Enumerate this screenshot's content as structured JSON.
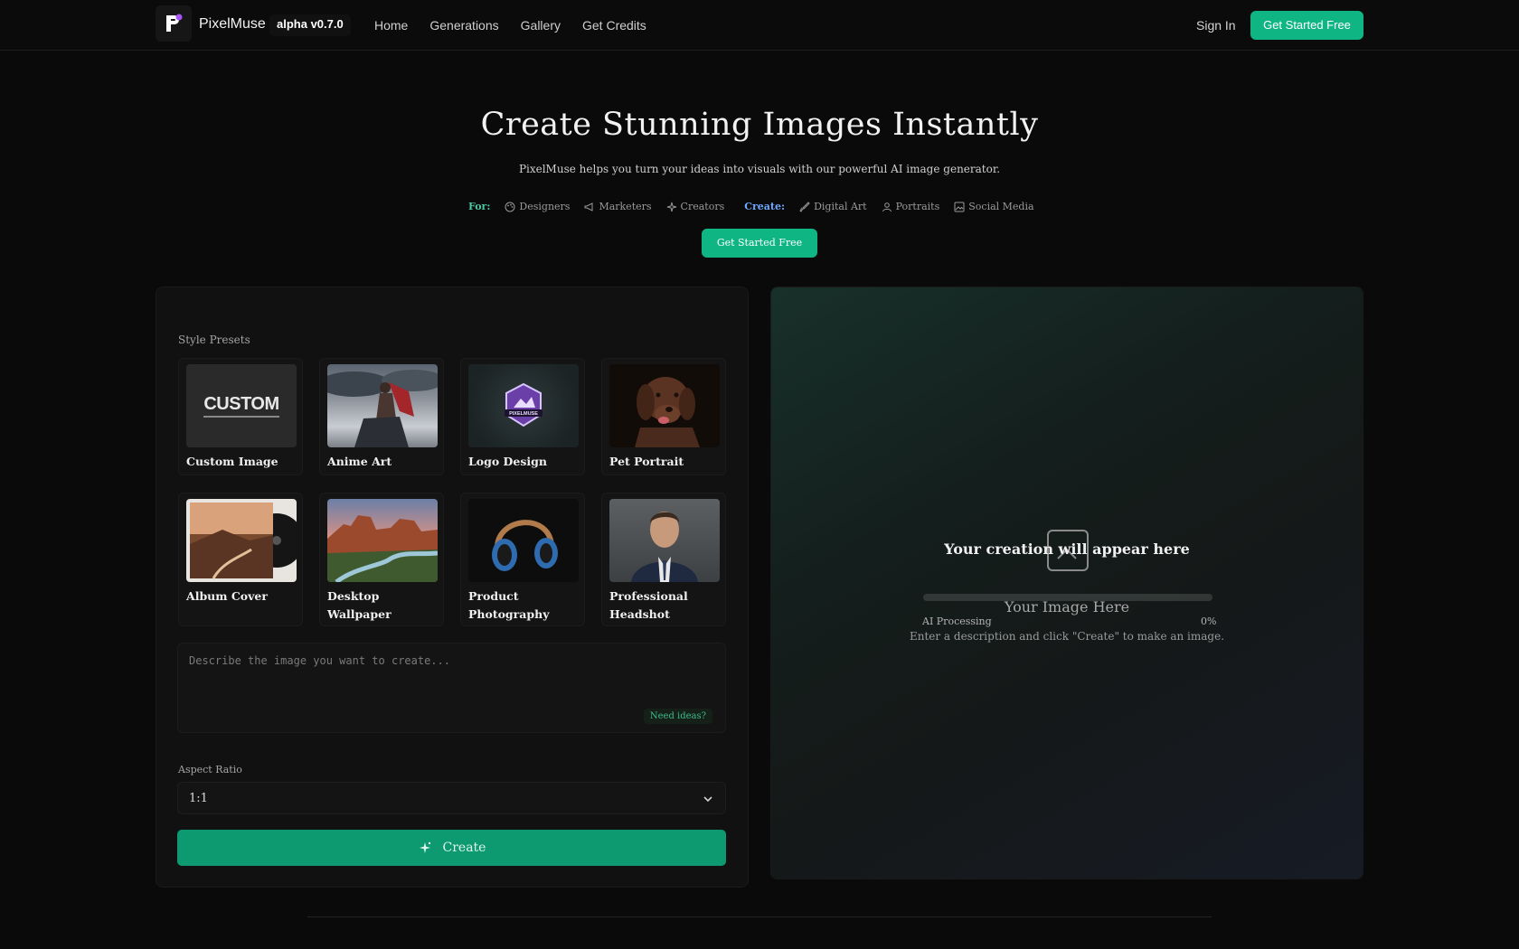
{
  "nav": {
    "brand": "PixelMuse",
    "version": "alpha v0.7.0",
    "links": [
      "Home",
      "Generations",
      "Gallery",
      "Get Credits"
    ],
    "signin": "Sign In",
    "cta": "Get Started Free"
  },
  "hero": {
    "title": "Create Stunning Images Instantly",
    "subtitle": "PixelMuse helps you turn your ideas into visuals with our powerful AI image generator.",
    "for_label": "For:",
    "for_tags": [
      "Designers",
      "Marketers",
      "Creators"
    ],
    "create_label": "Create:",
    "create_tags": [
      "Digital Art",
      "Portraits",
      "Social Media"
    ],
    "cta": "Get Started Free"
  },
  "generator": {
    "presets_label": "Style Presets",
    "presets": [
      {
        "name": "Custom Image",
        "thumb_text": "CUSTOM"
      },
      {
        "name": "Anime Art"
      },
      {
        "name": "Logo Design",
        "thumb_text": "PIXELMUSE"
      },
      {
        "name": "Pet Portrait"
      },
      {
        "name": "Album Cover"
      },
      {
        "name": "Desktop Wallpaper"
      },
      {
        "name": "Product Photography"
      },
      {
        "name": "Professional Headshot"
      }
    ],
    "prompt_placeholder": "Describe the image you want to create...",
    "prompt_value": "",
    "need_ideas": "Need ideas?",
    "aspect_label": "Aspect Ratio",
    "aspect_value": "1:1",
    "create_label": "Create"
  },
  "preview": {
    "title": "Your creation will appear here",
    "image_here": "Your Image Here",
    "processing_label": "AI Processing",
    "processing_pct": "0%",
    "hint": "Enter a description and click \"Create\" to make an image."
  },
  "colors": {
    "accent": "#10b584",
    "background": "#0a0a0a",
    "panel": "#111111"
  }
}
